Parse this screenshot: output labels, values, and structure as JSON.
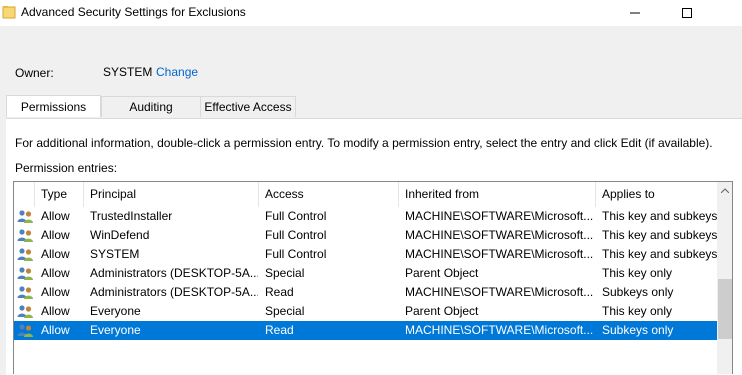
{
  "window": {
    "title": "Advanced Security Settings for Exclusions"
  },
  "owner": {
    "label": "Owner:",
    "value": "SYSTEM",
    "change_label": "Change"
  },
  "tabs": [
    {
      "label": "Permissions",
      "active": true
    },
    {
      "label": "Auditing",
      "active": false
    },
    {
      "label": "Effective Access",
      "active": false
    }
  ],
  "info_text": "For additional information, double-click a permission entry. To modify a permission entry, select the entry and click Edit (if available).",
  "entries_label": "Permission entries:",
  "table": {
    "columns": [
      "Type",
      "Principal",
      "Access",
      "Inherited from",
      "Applies to"
    ],
    "rows": [
      {
        "type": "Allow",
        "principal": "TrustedInstaller",
        "access": "Full Control",
        "inherited": "MACHINE\\SOFTWARE\\Microsoft...",
        "applies": "This key and subkeys",
        "selected": false
      },
      {
        "type": "Allow",
        "principal": "WinDefend",
        "access": "Full Control",
        "inherited": "MACHINE\\SOFTWARE\\Microsoft...",
        "applies": "This key and subkeys",
        "selected": false
      },
      {
        "type": "Allow",
        "principal": "SYSTEM",
        "access": "Full Control",
        "inherited": "MACHINE\\SOFTWARE\\Microsoft...",
        "applies": "This key and subkeys",
        "selected": false
      },
      {
        "type": "Allow",
        "principal": "Administrators (DESKTOP-5A...",
        "access": "Special",
        "inherited": "Parent Object",
        "applies": "This key only",
        "selected": false
      },
      {
        "type": "Allow",
        "principal": "Administrators (DESKTOP-5A...",
        "access": "Read",
        "inherited": "MACHINE\\SOFTWARE\\Microsoft...",
        "applies": "Subkeys only",
        "selected": false
      },
      {
        "type": "Allow",
        "principal": "Everyone",
        "access": "Special",
        "inherited": "Parent Object",
        "applies": "This key only",
        "selected": false
      },
      {
        "type": "Allow",
        "principal": "Everyone",
        "access": "Read",
        "inherited": "MACHINE\\SOFTWARE\\Microsoft...",
        "applies": "Subkeys only",
        "selected": true
      }
    ]
  },
  "icons": {
    "title": "folder-icon",
    "row": "users-icon",
    "minimize": "minimize-icon",
    "maximize": "maximize-icon",
    "scroll_up": "chevron-up-icon"
  },
  "colors": {
    "selection": "#0078d7",
    "link": "#0066cc",
    "folder": "#f8d775"
  }
}
